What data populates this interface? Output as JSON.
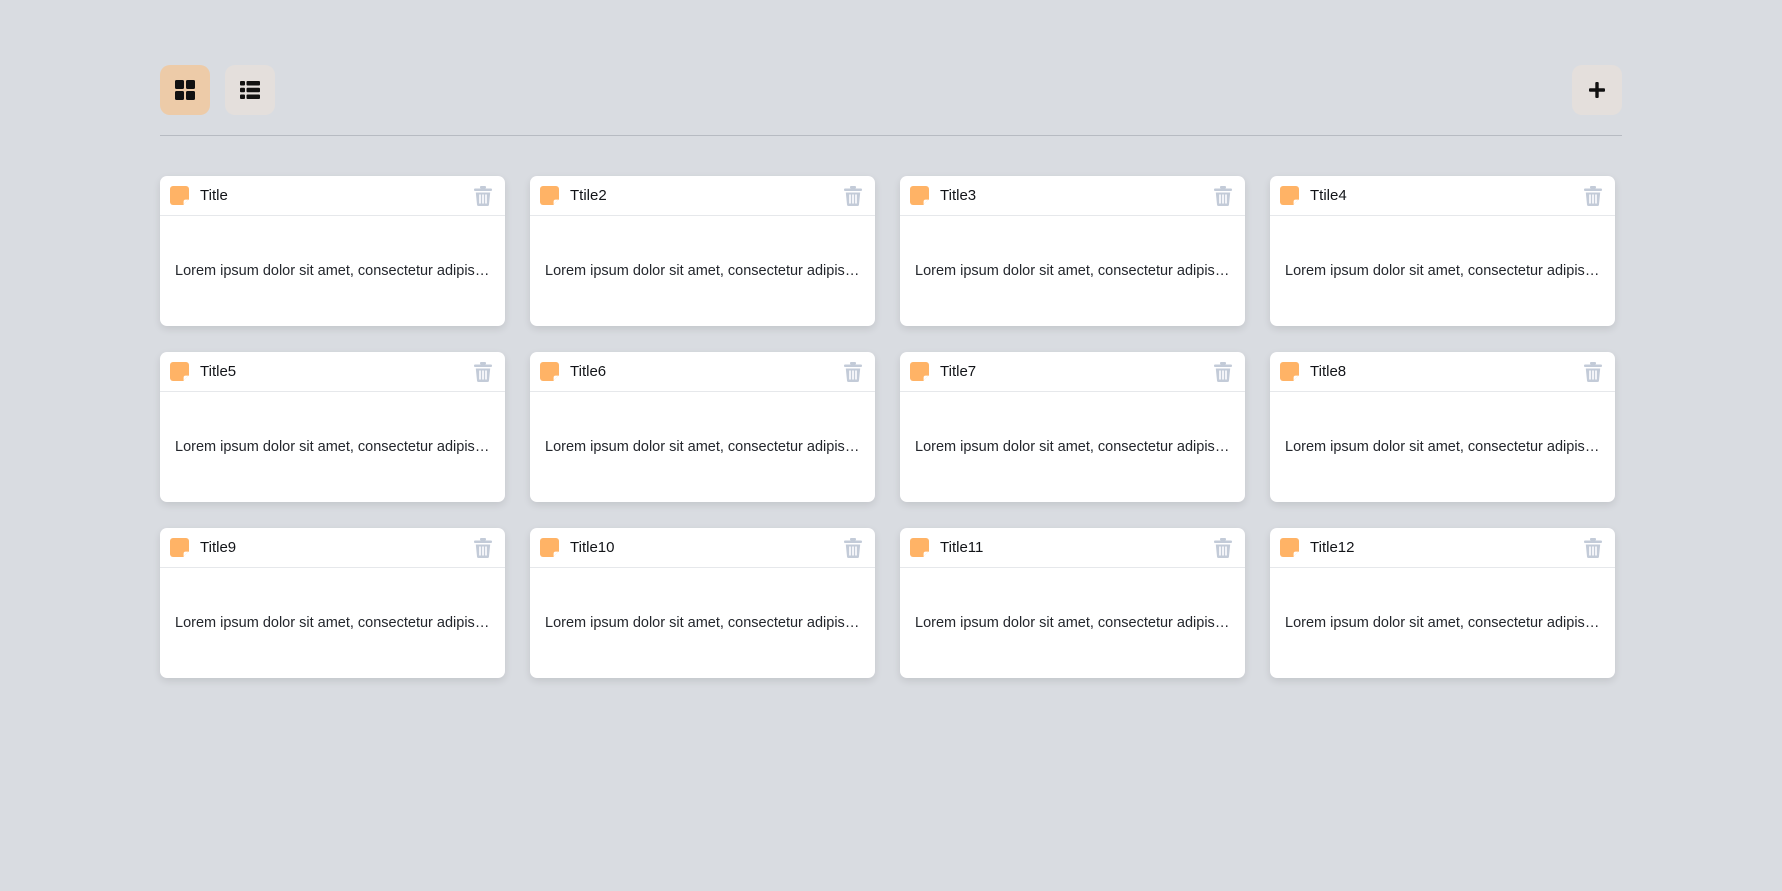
{
  "toolbar": {
    "grid_view_icon": "grid-icon",
    "list_view_icon": "list-icon",
    "add_icon": "plus-icon",
    "active_view": "grid",
    "active_color": "#edcba8",
    "inactive_color": "#e4dfdc"
  },
  "notes": [
    {
      "title": "Title",
      "body": "Lorem ipsum dolor sit amet, consectetur adipiscing elit, sed do eiusmod tempor"
    },
    {
      "title": "Ttile2",
      "body": "Lorem ipsum dolor sit amet, consectetur adipiscing elit, sed do eiusmod tempor"
    },
    {
      "title": "Title3",
      "body": "Lorem ipsum dolor sit amet, consectetur adipiscing elit, sed do eiusmod tempor"
    },
    {
      "title": "Ttile4",
      "body": "Lorem ipsum dolor sit amet, consectetur adipiscing elit, sed do eiusmod tempor"
    },
    {
      "title": "Title5",
      "body": "Lorem ipsum dolor sit amet, consectetur adipiscing elit, sed do eiusmod tempor"
    },
    {
      "title": "Title6",
      "body": "Lorem ipsum dolor sit amet, consectetur adipiscing elit, sed do eiusmod tempor"
    },
    {
      "title": "Title7",
      "body": "Lorem ipsum dolor sit amet, consectetur adipiscing elit, sed do eiusmod tempor"
    },
    {
      "title": "Title8",
      "body": "Lorem ipsum dolor sit amet, consectetur adipiscing elit, sed do eiusmod tempor"
    },
    {
      "title": "Title9",
      "body": "Lorem ipsum dolor sit amet, consectetur adipiscing elit, sed do eiusmod tempor"
    },
    {
      "title": "Title10",
      "body": "Lorem ipsum dolor sit amet, consectetur adipiscing elit, sed do eiusmod tempor"
    },
    {
      "title": "Title11",
      "body": "Lorem ipsum dolor sit amet, consectetur adipiscing elit, sed do eiusmod tempor"
    },
    {
      "title": "Title12",
      "body": "Lorem ipsum dolor sit amet, consectetur adipiscing elit, sed do eiusmod tempor"
    }
  ],
  "colors": {
    "background": "#d9dce1",
    "note_icon": "#ffb366",
    "trash_icon": "#c3cbd8"
  }
}
